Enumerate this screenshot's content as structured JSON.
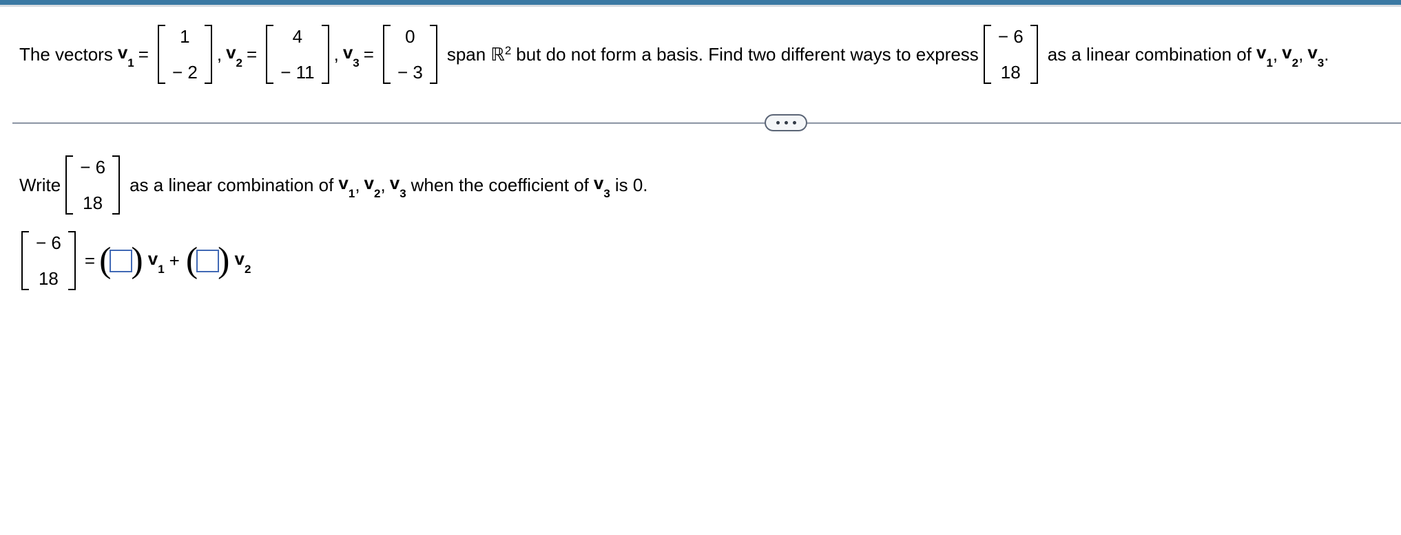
{
  "theme": {
    "top_bar_color": "#3b79a3",
    "divider_color": "#8b94a3",
    "input_border_color": "#4169b5",
    "text_color": "#000000",
    "background": "#ffffff"
  },
  "problem": {
    "lead_text": "The vectors",
    "v1_name": "v",
    "v1_sub": "1",
    "v1_eq": "=",
    "v1_vector": [
      "1",
      "− 2"
    ],
    "comma1": ",",
    "v2_name": "v",
    "v2_sub": "2",
    "v2_eq": "=",
    "v2_vector": [
      "4",
      "− 11"
    ],
    "comma2": ",",
    "v3_name": "v",
    "v3_sub": "3",
    "v3_eq": "=",
    "v3_vector": [
      "0",
      "− 3"
    ],
    "span_text": "span",
    "field_symbol": "ℝ",
    "field_exponent": "2",
    "mid_text": "but do not form a basis. Find two different ways to express",
    "target_vector": [
      "− 6",
      "18"
    ],
    "tail_text": "as a linear combination of",
    "tail_v1": "v",
    "tail_v1_sub": "1",
    "tail_comma1": ",",
    "tail_v2": "v",
    "tail_v2_sub": "2",
    "tail_comma2": ",",
    "tail_v3": "v",
    "tail_v3_sub": "3",
    "period": "."
  },
  "divider": {
    "dots_label": "•••",
    "dot_count": 3
  },
  "answer": {
    "write_text": "Write",
    "write_vector": [
      "− 6",
      "18"
    ],
    "write_mid": "as a linear combination of",
    "w_v1": "v",
    "w_v1_sub": "1",
    "w_comma1": ",",
    "w_v2": "v",
    "w_v2_sub": "2",
    "w_comma2": ",",
    "w_v3": "v",
    "w_v3_sub": "3",
    "write_when": "when the coefficient of",
    "w_v3b": "v",
    "w_v3b_sub": "3",
    "write_is": "is 0.",
    "equation": {
      "lhs_vector": [
        "− 6",
        "18"
      ],
      "equals": "=",
      "open_paren": "(",
      "close_paren": ")",
      "coef1_value": "",
      "coef1_placeholder": "",
      "term1_name": "v",
      "term1_sub": "1",
      "plus": "+",
      "coef2_value": "",
      "coef2_placeholder": "",
      "term2_name": "v",
      "term2_sub": "2"
    }
  }
}
